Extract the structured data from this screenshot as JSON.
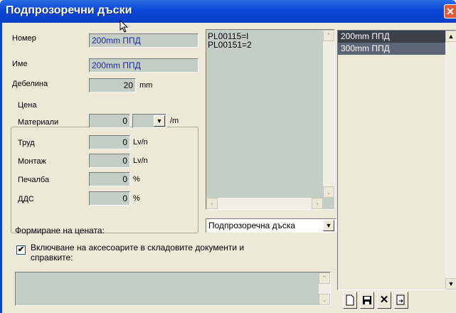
{
  "window": {
    "title": "Подпрозоречни дъски",
    "close": "✕"
  },
  "fields": {
    "nomer_label": "Номер",
    "nomer_value": "200mm ППД",
    "ime_label": "Име",
    "ime_value": "200mm ППД",
    "debelina_label": "Дебелина",
    "debelina_value": "20",
    "debelina_unit": "mm"
  },
  "price": {
    "group_label": "Цена",
    "materiali_label": "Материали",
    "materiali_value": "0",
    "materiali_unit": "/m",
    "trud_label": "Труд",
    "trud_value": "0",
    "trud_unit": "Lv/n",
    "montazh_label": "Монтаж",
    "montazh_value": "0",
    "montazh_unit": "Lv/n",
    "pechalba_label": "Печалба",
    "pechalba_value": "0",
    "pechalba_unit": "%",
    "dds_label": "ДДС",
    "dds_value": "0",
    "dds_unit": "%"
  },
  "codes_list": [
    "PL00115=I",
    "PL00151=2"
  ],
  "formation": {
    "label": "Формиране на цената:",
    "value": "Подпрозоречна дъска"
  },
  "include_check": {
    "label_line1": "Включване на аксесоарите в складовите документи и",
    "label_line2": "справките:",
    "checked": "✔"
  },
  "right_list": [
    "200mm ППД",
    "300mm ППД"
  ],
  "toolbar": {
    "new_icon": "new-file-icon",
    "save_icon": "save-icon",
    "delete_icon": "delete-icon",
    "export_icon": "export-icon",
    "delete_glyph": "✕"
  }
}
